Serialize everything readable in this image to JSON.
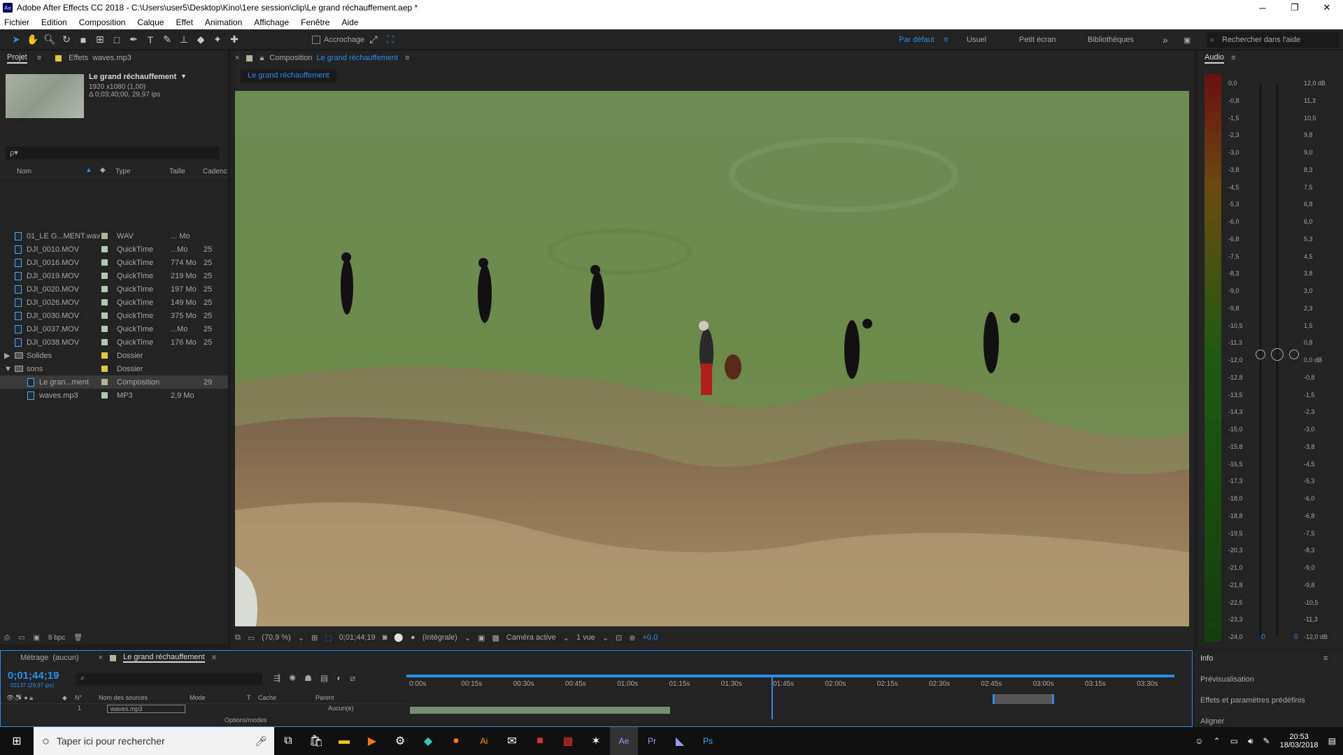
{
  "window": {
    "title": "Adobe After Effects CC 2018 - C:\\Users\\user5\\Desktop\\Kino\\1ere session\\clip\\Le grand réchauffement.aep *",
    "app_icon": "Ae"
  },
  "menu": [
    "Fichier",
    "Edition",
    "Composition",
    "Calque",
    "Effet",
    "Animation",
    "Affichage",
    "Fenêtre",
    "Aide"
  ],
  "toolbar": {
    "snap_label": "Accrochage",
    "workspaces": [
      "Par défaut",
      "Usuel",
      "Petit écran",
      "Bibliothèques"
    ],
    "search_placeholder": "Rechercher dans l'aide"
  },
  "project": {
    "tab_project": "Projet",
    "tab_effects": "Effets",
    "tab_effects_file": "waves.mp3",
    "thumb_title": "Le grand réchauffement",
    "thumb_info1": "1920 x1080 (1,00)",
    "thumb_info2": "Δ 0;03;40;00, 29,97 ips",
    "search_placeholder": "ρ▾",
    "col_name": "Nom",
    "col_type": "Type",
    "col_size": "Taille",
    "col_rate": "Cadenc",
    "items": [
      {
        "name": "01_LE G...MENT.wav",
        "type": "WAV",
        "size": "... Mo",
        "rate": "",
        "color": "#b3b39b"
      },
      {
        "name": "DJI_0010.MOV",
        "type": "QuickTime",
        "size": "...Mo",
        "rate": "25",
        "color": "#b3c8b3"
      },
      {
        "name": "DJI_0016.MOV",
        "type": "QuickTime",
        "size": "774 Mo",
        "rate": "25",
        "color": "#b3c8b3"
      },
      {
        "name": "DJI_0019.MOV",
        "type": "QuickTime",
        "size": "219 Mo",
        "rate": "25",
        "color": "#b3c8b3"
      },
      {
        "name": "DJI_0020.MOV",
        "type": "QuickTime",
        "size": "197 Mo",
        "rate": "25",
        "color": "#b3c8b3"
      },
      {
        "name": "DJI_0026.MOV",
        "type": "QuickTime",
        "size": "149 Mo",
        "rate": "25",
        "color": "#b3c8b3"
      },
      {
        "name": "DJI_0030.MOV",
        "type": "QuickTime",
        "size": "375 Mo",
        "rate": "25",
        "color": "#b3c8b3"
      },
      {
        "name": "DJI_0037.MOV",
        "type": "QuickTime",
        "size": "...Mo",
        "rate": "25",
        "color": "#b3c8b3"
      },
      {
        "name": "DJI_0038.MOV",
        "type": "QuickTime",
        "size": "176 Mo",
        "rate": "25",
        "color": "#b3c8b3"
      },
      {
        "name": "Solides",
        "type": "Dossier",
        "size": "",
        "rate": "",
        "color": "#e0c840"
      },
      {
        "name": "sons",
        "type": "Dossier",
        "size": "",
        "rate": "",
        "color": "#e0c840"
      },
      {
        "name": "Le gran...ment",
        "type": "Composition",
        "size": "",
        "rate": "29",
        "color": "#b3b39b"
      },
      {
        "name": "waves.mp3",
        "type": "MP3",
        "size": "2,9 Mo",
        "rate": "",
        "color": "#b3c8b3"
      }
    ],
    "bpc": "8 bpc"
  },
  "composition": {
    "tab_label": "Composition",
    "tab_name": "Le grand réchauffement",
    "breadcrumb": "Le grand réchauffement",
    "zoom": "(70,9 %)",
    "timecode": "0;01;44;19",
    "resolution": "(Intégrale)",
    "camera": "Caméra active",
    "views": "1 vue",
    "exposure": "+0,0"
  },
  "audio": {
    "tab": "Audio",
    "left_scale": [
      "0,0",
      "-0,8",
      "-1,5",
      "-2,3",
      "-3,0",
      "-3,8",
      "-4,5",
      "-5,3",
      "-6,0",
      "-6,8",
      "-7,5",
      "-8,3",
      "-9,0",
      "-9,8",
      "-10,5",
      "-11,3",
      "-12,0",
      "-12,8",
      "-13,5",
      "-14,3",
      "-15,0",
      "-15,8",
      "-16,5",
      "-17,3",
      "-18,0",
      "-18,8",
      "-19,5",
      "-20,3",
      "-21,0",
      "-21,8",
      "-22,5",
      "-23,3",
      "-24,0"
    ],
    "right_scale": [
      "12,0 dB",
      "11,3",
      "10,5",
      "9,8",
      "9,0",
      "8,3",
      "7,5",
      "6,8",
      "6,0",
      "5,3",
      "4,5",
      "3,8",
      "3,0",
      "2,3",
      "1,5",
      "0,8",
      "0,0 dB",
      "-0,8",
      "-1,5",
      "-2,3",
      "-3,0",
      "-3,8",
      "-4,5",
      "-5,3",
      "-6,0",
      "-6,8",
      "-7,5",
      "-8,3",
      "-9,0",
      "-9,8",
      "-10,5",
      "-11,3",
      "-12,0 dB"
    ],
    "left_value": "0",
    "right_value": "0"
  },
  "timeline": {
    "tab_footage": "Métrage",
    "tab_footage_none": "(aucun)",
    "tab_comp": "Le grand réchauffement",
    "timecode": "0;01;44;19",
    "timecode_sub": "03137 (29,97 ips)",
    "cols": {
      "num": "N°",
      "source": "Nom des sources",
      "mode": "Mode",
      "t": "T",
      "mask": "Cache",
      "parent": "Parent"
    },
    "layer": {
      "num": "1",
      "name": "waves.mp3",
      "parent": "Aucun(e)"
    },
    "ruler": [
      "0:00s",
      "00:15s",
      "00:30s",
      "00:45s",
      "01:00s",
      "01:15s",
      "01:30s",
      "01:45s",
      "02:00s",
      "02:15s",
      "02:30s",
      "02:45s",
      "03:00s",
      "03:15s",
      "03:30s"
    ],
    "options": "Options/modes"
  },
  "info": {
    "tab": "Info",
    "items": [
      "Prévisualisation",
      "Effets et paramètres prédéfinis",
      "Aligner"
    ]
  },
  "taskbar": {
    "search": "Taper ici pour rechercher",
    "time": "20:53",
    "date": "18/03/2018"
  }
}
